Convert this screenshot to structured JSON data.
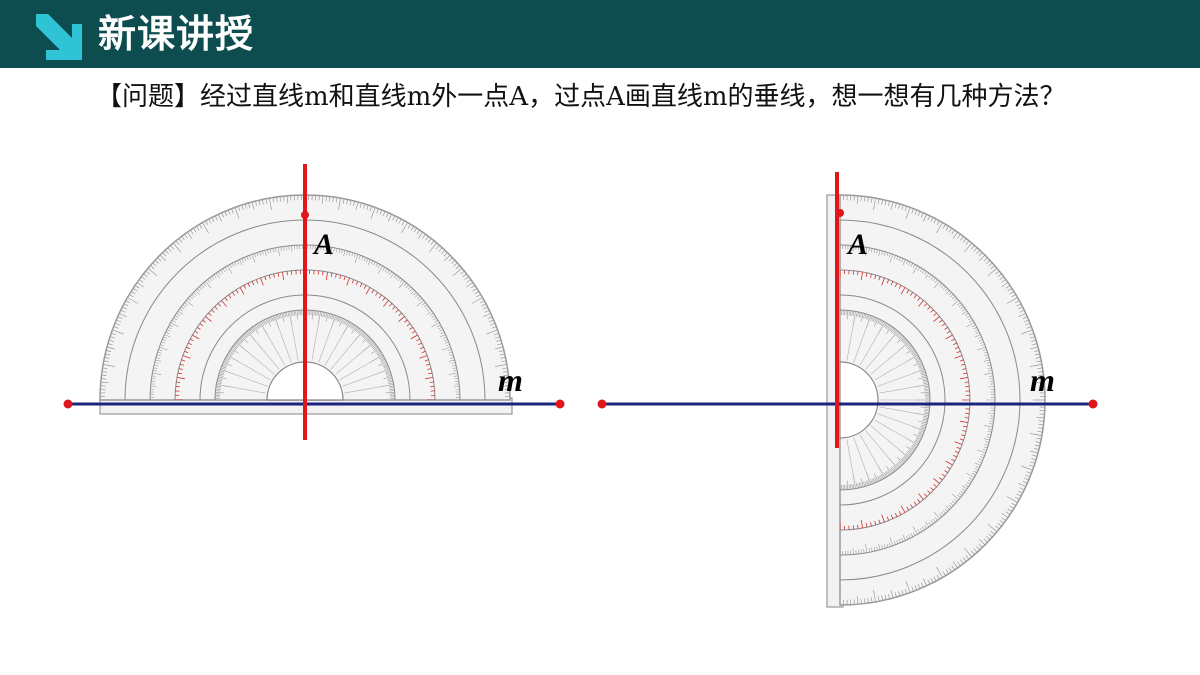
{
  "header": {
    "title": "新课讲授",
    "bg_color": "#0d4d50",
    "icon": "diagonal-arrow-icon",
    "icon_color": "#2ec4d6"
  },
  "question": {
    "text": "【问题】经过直线m和直线m外一点A，过点A画直线m的垂线，想一想有几种方法？"
  },
  "figures": {
    "left": {
      "point_label": "A",
      "line_label": "m"
    },
    "right": {
      "point_label": "A",
      "line_label": "m"
    }
  },
  "colors": {
    "line_m": "#1a237e",
    "perpendicular": "#e0161b",
    "endpoint": "#e0161b",
    "protractor_body": "#f4f4f4",
    "protractor_stroke": "#9a9a9a",
    "scale_red": "#d32f2f"
  }
}
